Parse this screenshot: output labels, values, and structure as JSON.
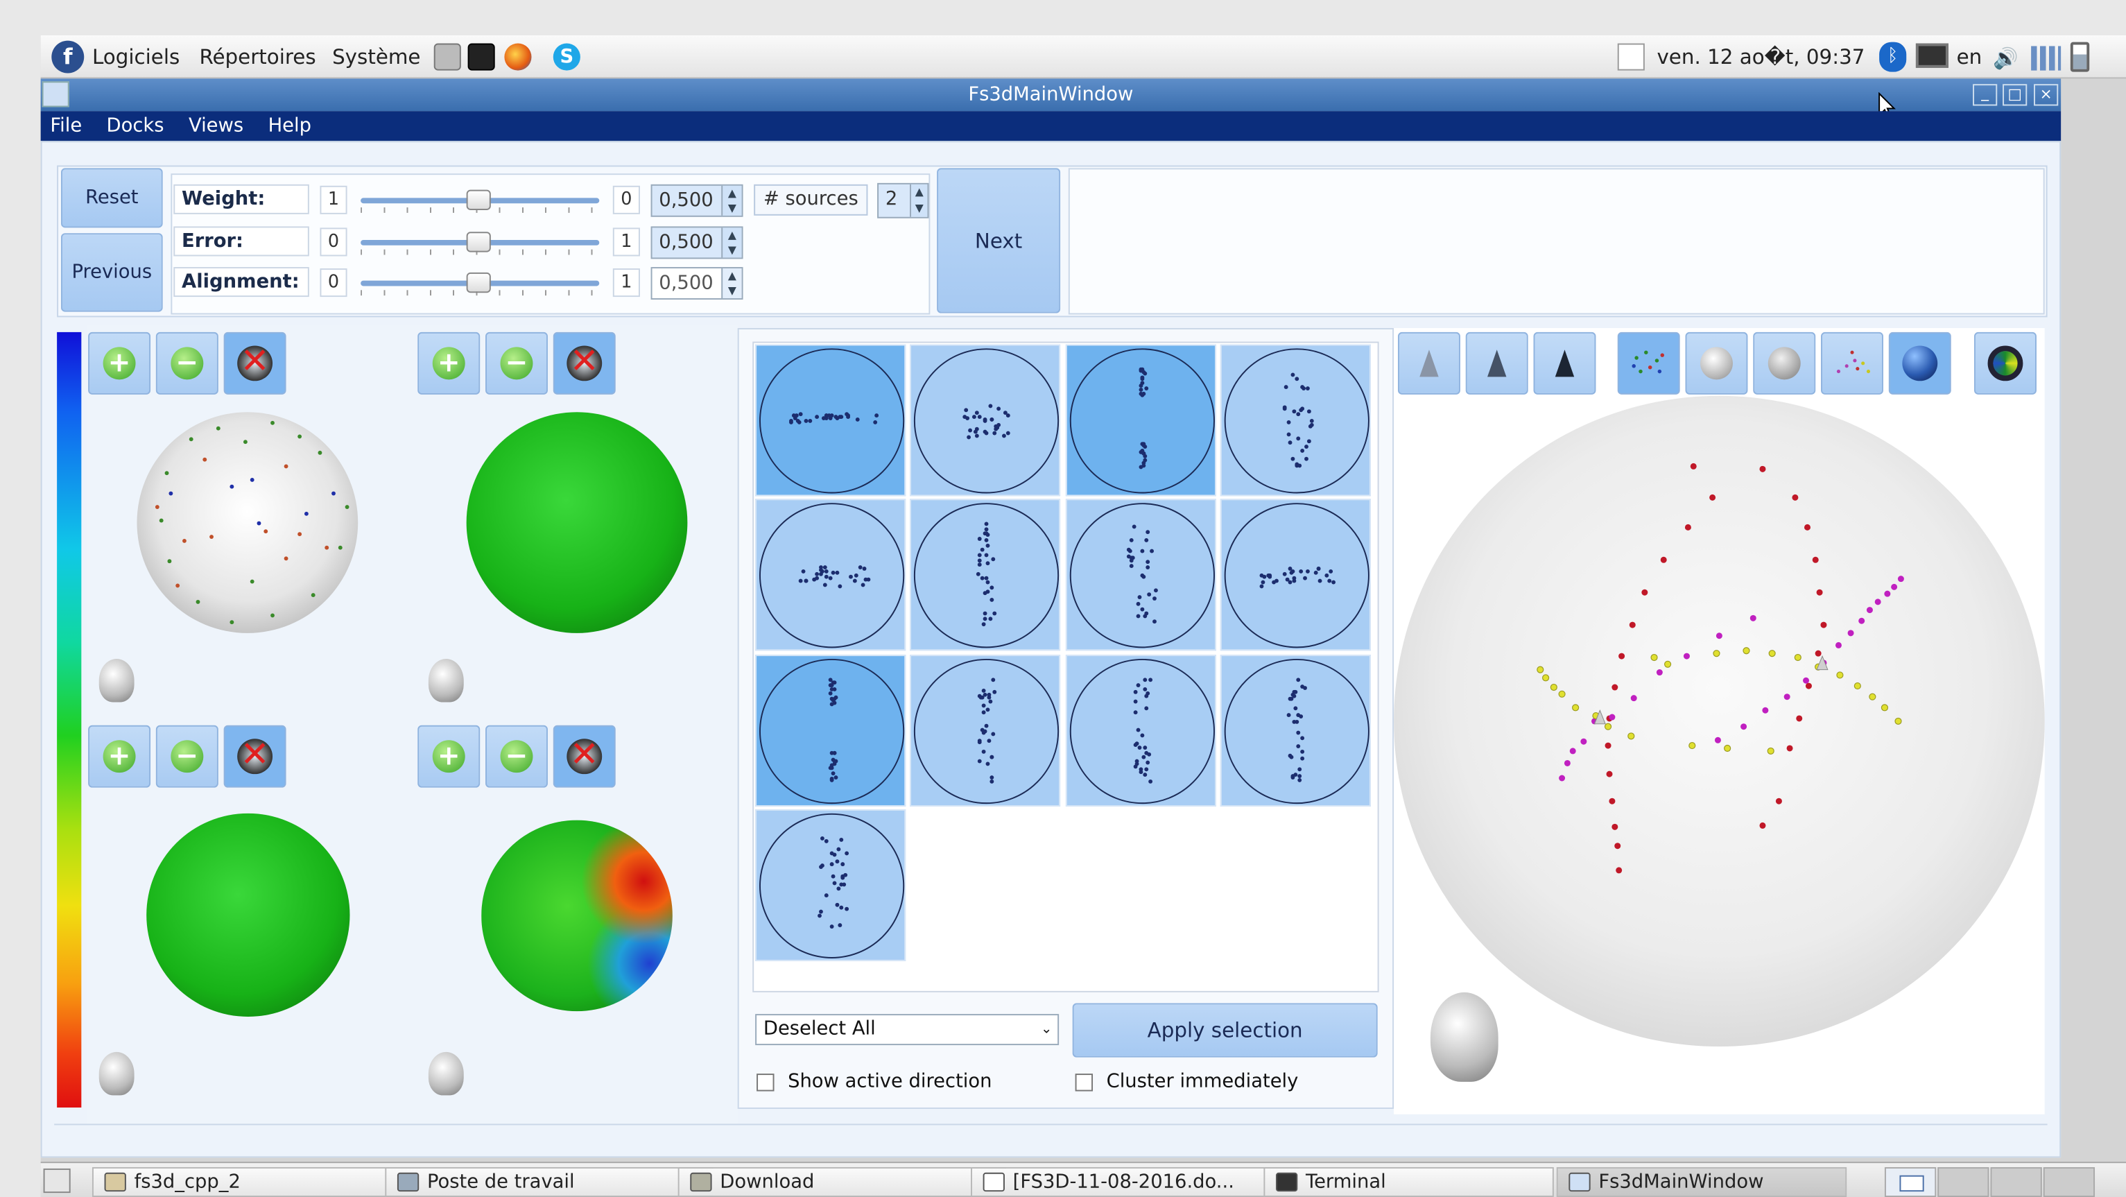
{
  "top_panel": {
    "menus": [
      "Logiciels",
      "Répertoires",
      "Système"
    ],
    "clock": "ven. 12 ao�t, 09:37",
    "keyboard_layout": "en"
  },
  "window": {
    "title": "Fs3dMainWindow",
    "menubar": [
      "File",
      "Docks",
      "Views",
      "Help"
    ]
  },
  "controls": {
    "reset_label": "Reset",
    "previous_label": "Previous",
    "next_label": "Next",
    "rows": [
      {
        "label": "Weight:",
        "min": "1",
        "max": "0",
        "value": "0,500",
        "slider_fraction": 0.5
      },
      {
        "label": "Error:",
        "min": "0",
        "max": "1",
        "value": "0,500",
        "slider_fraction": 0.5
      },
      {
        "label": "Alignment:",
        "min": "0",
        "max": "1",
        "value": "0,500",
        "slider_fraction": 0.5
      }
    ],
    "sources_label": "# sources",
    "sources_value": "2"
  },
  "grid": {
    "selected_cells": [
      0,
      2,
      8
    ]
  },
  "selection": {
    "dropdown_value": "Deselect All",
    "apply_label": "Apply selection",
    "show_active_label": "Show active direction",
    "cluster_label": "Cluster immediately"
  },
  "taskbar": {
    "tasks": [
      "fs3d_cpp_2",
      "Poste de travail",
      "Download",
      "[FS3D-11-08-2016.do...",
      "Terminal",
      "Fs3dMainWindow"
    ]
  },
  "colors": {
    "menubar": "#0b2d7c",
    "titlebar": "#3a6eae",
    "button": "#a6c9f2",
    "selected_cell": "#6eb2ee"
  }
}
